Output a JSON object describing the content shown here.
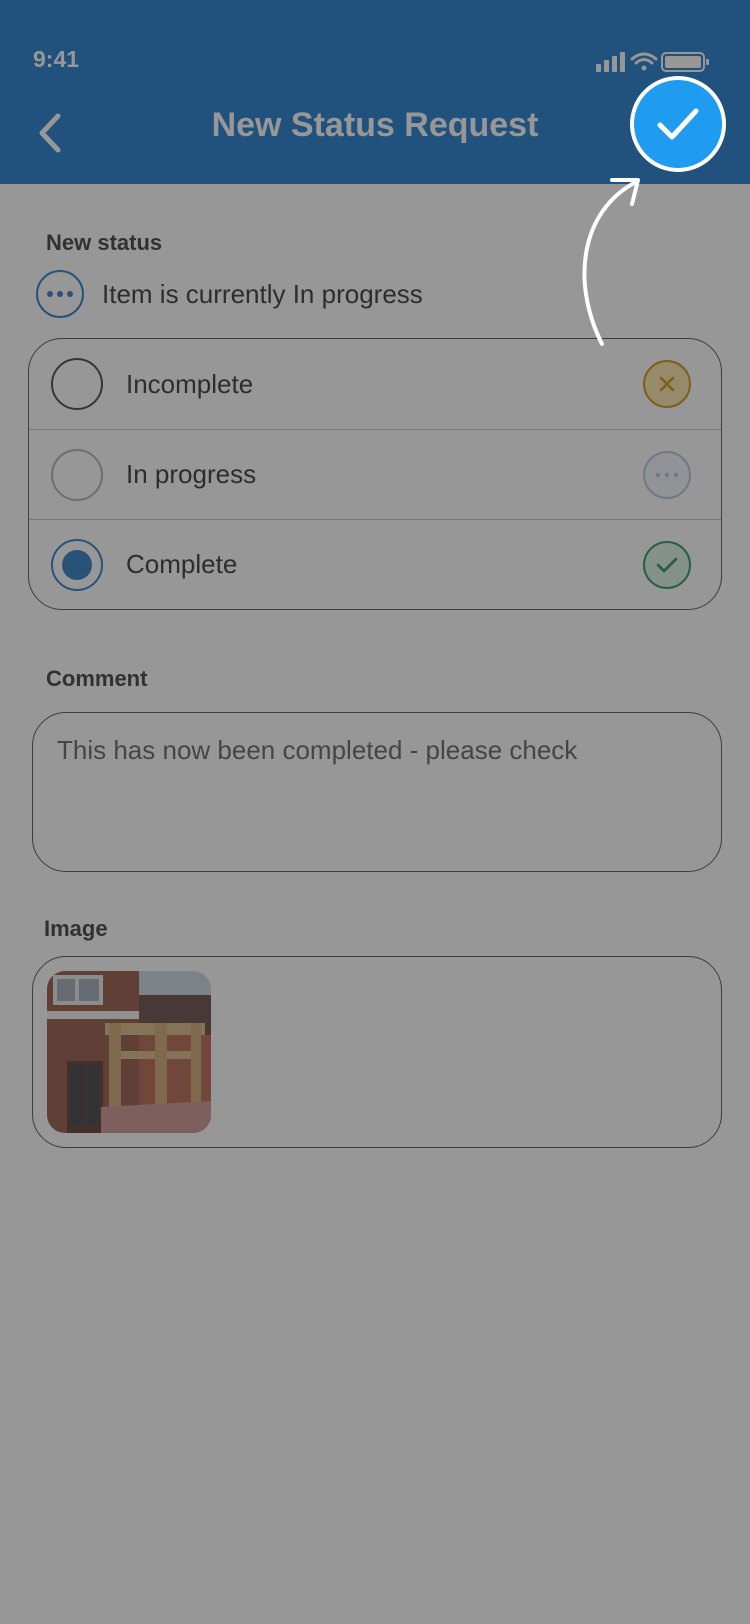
{
  "status_bar": {
    "time": "9:41"
  },
  "header": {
    "title": "New Status Request"
  },
  "new_status": {
    "label": "New status",
    "current_text": "Item is currently In progress",
    "options": [
      {
        "label": "Incomplete",
        "icon": "x-icon",
        "selected": false
      },
      {
        "label": "In progress",
        "icon": "dots-icon",
        "selected": false
      },
      {
        "label": "Complete",
        "icon": "check-icon",
        "selected": true
      }
    ]
  },
  "comment": {
    "label": "Comment",
    "value": "This has now been completed - please check"
  },
  "image": {
    "label": "Image"
  },
  "colors": {
    "header": "#0a6fc6",
    "accent": "#1f9bf0",
    "selected": "#1a6fbf",
    "incomplete": "#c68a00",
    "complete": "#1a8a4e"
  }
}
